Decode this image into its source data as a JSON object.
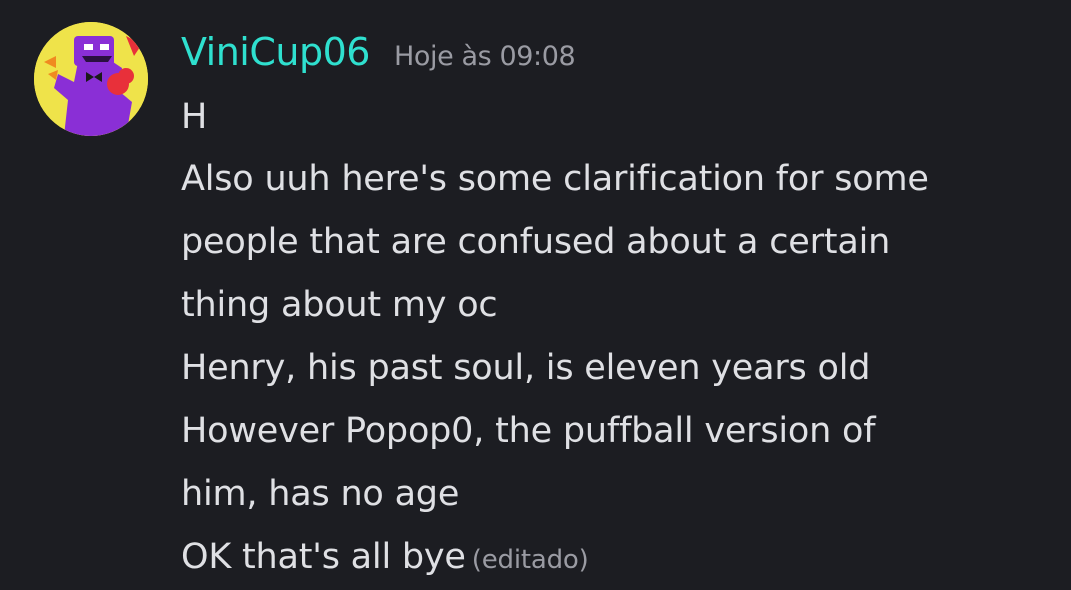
{
  "message": {
    "username": "ViniCup06",
    "timestamp": "Hoje às 09:08",
    "avatar_icon": "character-avatar-icon",
    "lines": [
      "H",
      "Also uuh here's some clarification for some",
      "people that are confused about a certain",
      "thing about my oc",
      "Henry, his past soul, is eleven years old",
      "However Popop0, the puffball version of",
      "him, has no age",
      "OK that's all bye"
    ],
    "edited_label": "(editado)"
  },
  "colors": {
    "background": "#1c1d22",
    "username": "#2fe0cf",
    "text": "#dfe0e4",
    "muted": "#9a9ba3",
    "avatar_bg": "#efe34a",
    "avatar_character": "#8a2fd6"
  }
}
